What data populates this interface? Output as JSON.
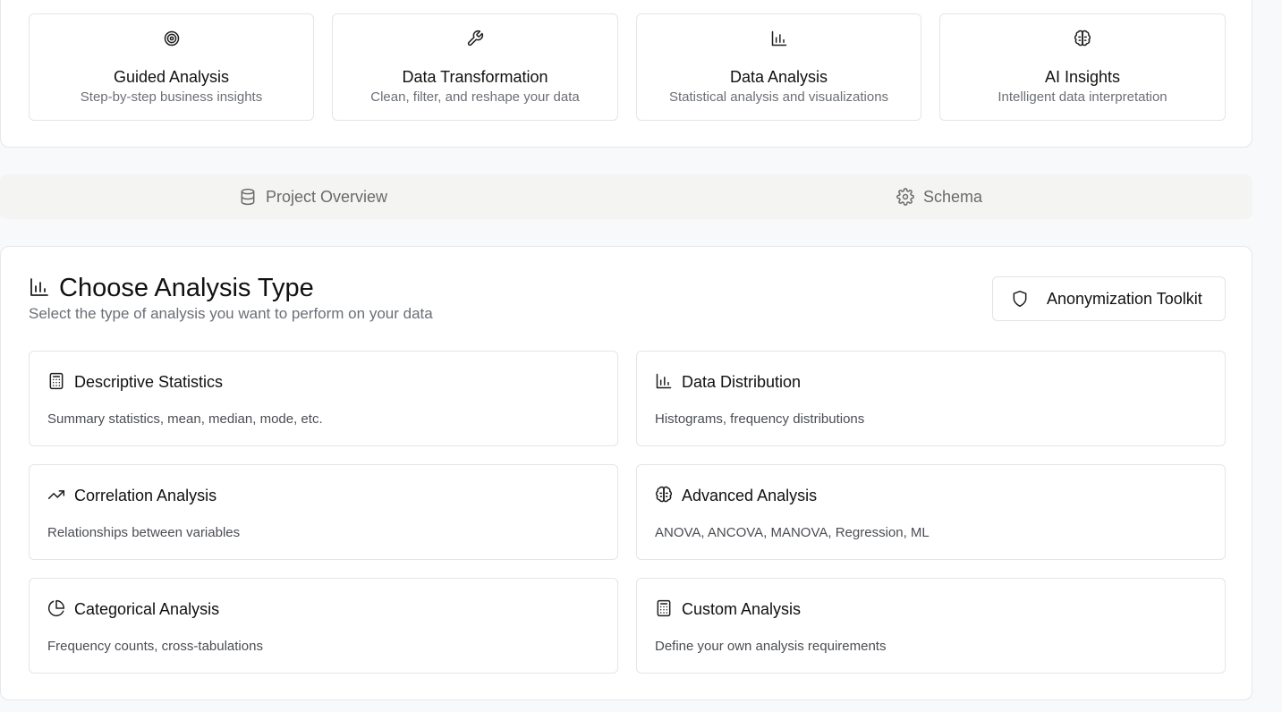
{
  "modes": [
    {
      "title": "Guided Analysis",
      "desc": "Step-by-step business insights",
      "icon": "target-icon"
    },
    {
      "title": "Data Transformation",
      "desc": "Clean, filter, and reshape your data",
      "icon": "wrench-icon"
    },
    {
      "title": "Data Analysis",
      "desc": "Statistical analysis and visualizations",
      "icon": "bar-chart-icon"
    },
    {
      "title": "AI Insights",
      "desc": "Intelligent data interpretation",
      "icon": "brain-icon"
    }
  ],
  "tabs": [
    {
      "label": "Project Overview",
      "icon": "database-icon"
    },
    {
      "label": "Schema",
      "icon": "gear-icon"
    }
  ],
  "section": {
    "title": "Choose Analysis Type",
    "subtitle": "Select the type of analysis you want to perform on your data",
    "toolkit_label": "Anonymization Toolkit"
  },
  "analysis_types": [
    {
      "title": "Descriptive Statistics",
      "desc": "Summary statistics, mean, median, mode, etc.",
      "icon": "calculator-icon"
    },
    {
      "title": "Data Distribution",
      "desc": "Histograms, frequency distributions",
      "icon": "bar-chart-icon"
    },
    {
      "title": "Correlation Analysis",
      "desc": "Relationships between variables",
      "icon": "trending-up-icon"
    },
    {
      "title": "Advanced Analysis",
      "desc": "ANOVA, ANCOVA, MANOVA, Regression, ML",
      "icon": "brain-icon"
    },
    {
      "title": "Categorical Analysis",
      "desc": "Frequency counts, cross-tabulations",
      "icon": "pie-chart-icon"
    },
    {
      "title": "Custom Analysis",
      "desc": "Define your own analysis requirements",
      "icon": "calculator-icon"
    }
  ]
}
